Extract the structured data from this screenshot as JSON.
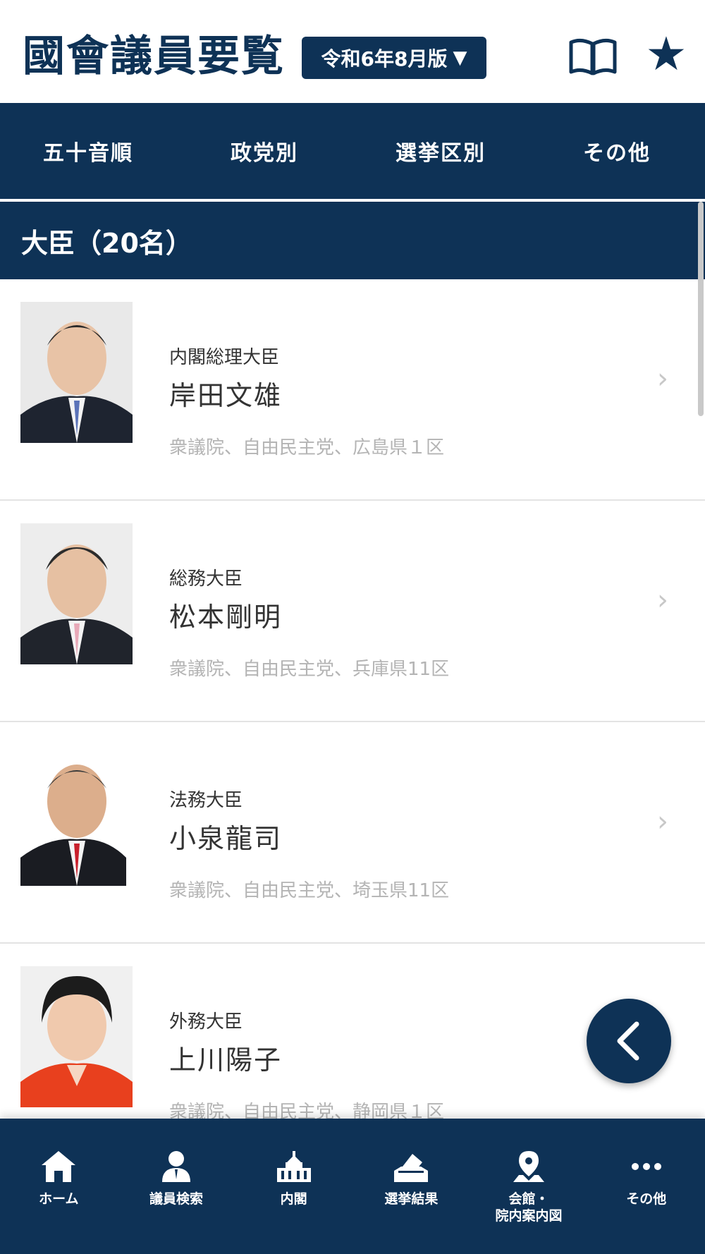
{
  "header": {
    "title": "國會議員要覧",
    "edition": "令和6年8月版",
    "edition_caret": "▼"
  },
  "tabs": [
    {
      "label": "五十音順"
    },
    {
      "label": "政党別"
    },
    {
      "label": "選挙区別"
    },
    {
      "label": "その他"
    }
  ],
  "section": {
    "title": "大臣（20名）"
  },
  "ministers": [
    {
      "role": "内閣総理大臣",
      "name": "岸田文雄",
      "meta": "衆議院、自由民主党、広島県１区"
    },
    {
      "role": "総務大臣",
      "name": "松本剛明",
      "meta": "衆議院、自由民主党、兵庫県11区"
    },
    {
      "role": "法務大臣",
      "name": "小泉龍司",
      "meta": "衆議院、自由民主党、埼玉県11区"
    },
    {
      "role": "外務大臣",
      "name": "上川陽子",
      "meta": "衆議院、自由民主党、静岡県１区"
    }
  ],
  "chevron": "›",
  "bottom_nav": [
    {
      "label": "ホーム",
      "icon": "home-icon"
    },
    {
      "label": "議員検索",
      "icon": "person-icon"
    },
    {
      "label": "内閣",
      "icon": "building-icon"
    },
    {
      "label": "選挙結果",
      "icon": "ballot-icon"
    },
    {
      "label": "会館・\n院内案内図",
      "icon": "map-pin-icon"
    },
    {
      "label": "その他",
      "icon": "more-icon"
    }
  ],
  "colors": {
    "primary": "#0e3256",
    "meta_text": "#b4b4b4",
    "divider": "#e3e3e3"
  }
}
